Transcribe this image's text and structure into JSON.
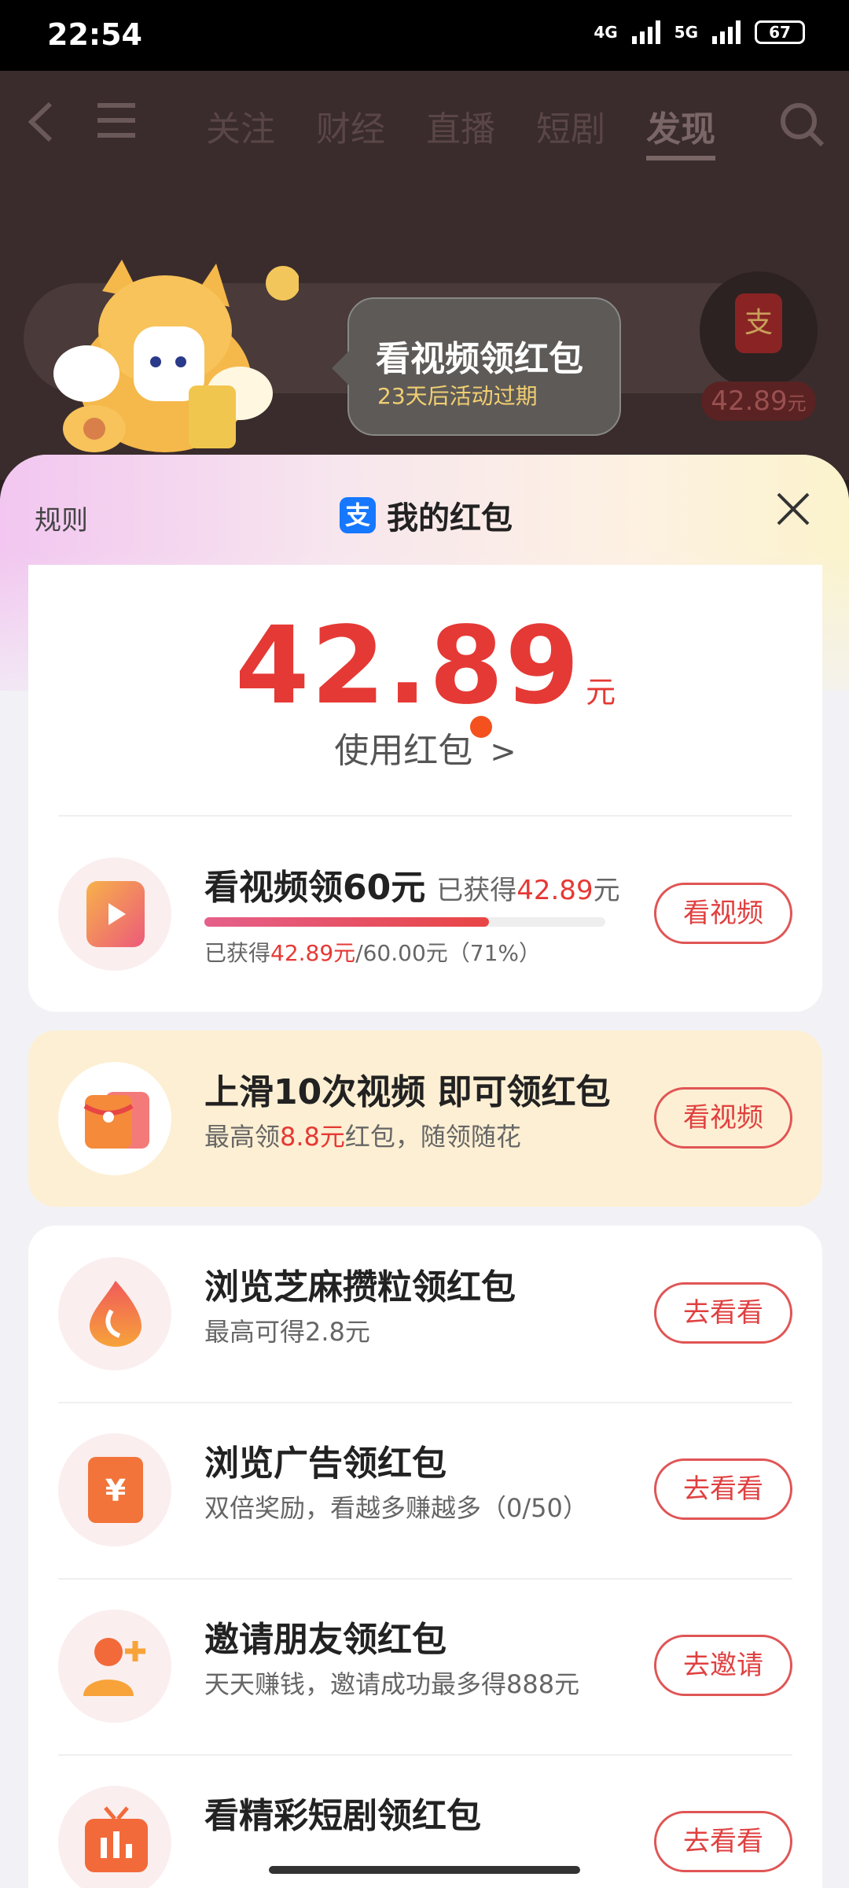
{
  "status_bar": {
    "time": "22:54",
    "net1": "4G",
    "net2": "5G",
    "battery": "67"
  },
  "background_app": {
    "tabs": [
      "关注",
      "财经",
      "直播",
      "短剧",
      "发现"
    ],
    "active_tab_index": 4,
    "banner_amount": "42.89",
    "banner_amount_unit": "元",
    "banner_badge": "支"
  },
  "tooltip": {
    "title": "看视频领红包",
    "subtitle": "23天后活动过期"
  },
  "sheet": {
    "rules": "规则",
    "title": "我的红包",
    "app_badge": "支",
    "balance": "42.89",
    "balance_unit": "元",
    "use_link": "使用红包",
    "use_chevron": ">"
  },
  "video_task": {
    "title": "看视频领60元",
    "earned_label": "已获得",
    "earned_value": "42.89",
    "earned_unit": "元",
    "progress_prefix": "已获得",
    "progress_value": "42.89元",
    "progress_rest": "/60.00元（71%）",
    "progress_fraction": 0.71,
    "button": "看视频"
  },
  "swipe_task": {
    "title": "上滑10次视频 即可领红包",
    "sub_prefix": "最高领",
    "sub_value": "8.8元",
    "sub_rest": "红包，随领随花",
    "button": "看视频"
  },
  "tasks": [
    {
      "title": "浏览芝麻攒粒领红包",
      "sub": "最高可得2.8元",
      "button": "去看看",
      "icon": "sesame-drop-icon"
    },
    {
      "title": "浏览广告领红包",
      "sub": "双倍奖励，看越多赚越多（0/50）",
      "button": "去看看",
      "icon": "yuan-icon"
    },
    {
      "title": "邀请朋友领红包",
      "sub": "天天赚钱，邀请成功最多得888元",
      "button": "去邀请",
      "icon": "add-friend-icon"
    },
    {
      "title": "看精彩短剧领红包",
      "sub": "",
      "button": "去看看",
      "icon": "tv-icon"
    }
  ],
  "colors": {
    "accent_red": "#e53935",
    "alipay_blue": "#1677ff",
    "swipe_card_bg": "#fdefd3"
  }
}
